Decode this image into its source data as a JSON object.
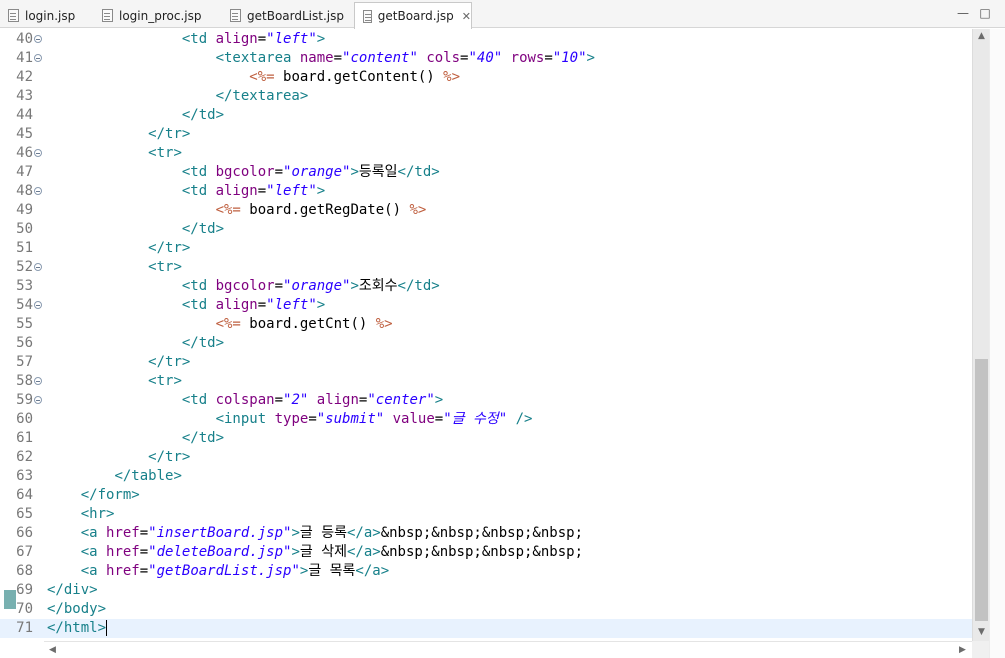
{
  "tabs": [
    {
      "label": "login.jsp",
      "active": false
    },
    {
      "label": "login_proc.jsp",
      "active": false
    },
    {
      "label": "getBoardList.jsp",
      "active": false
    },
    {
      "label": "getBoard.jsp",
      "active": true
    }
  ],
  "window_controls": {
    "minimize": "—",
    "maximize": "□"
  },
  "icons": {
    "file": "jsp-file-icon",
    "close": "close-icon",
    "fold": "fold-collapse-icon"
  },
  "colors": {
    "tag": "#17808a",
    "attribute": "#7f007f",
    "value": "#2a00ff",
    "scriptlet": "#bf5f3f",
    "current_line": "#e8f2fe"
  },
  "editor": {
    "current_line": 71,
    "lines": [
      {
        "num": 40,
        "fold": true,
        "tokens": [
          [
            "",
            "                "
          ],
          [
            "tg",
            "<td "
          ],
          [
            "at",
            "align"
          ],
          [
            "tx",
            "="
          ],
          [
            "vl",
            "\"left\""
          ],
          [
            "tg",
            ">"
          ]
        ]
      },
      {
        "num": 41,
        "fold": true,
        "tokens": [
          [
            "",
            "                    "
          ],
          [
            "tg",
            "<textarea "
          ],
          [
            "at",
            "name"
          ],
          [
            "tx",
            "="
          ],
          [
            "vl",
            "\"content\""
          ],
          [
            "tx",
            " "
          ],
          [
            "at",
            "cols"
          ],
          [
            "tx",
            "="
          ],
          [
            "vl",
            "\"40\""
          ],
          [
            "tx",
            " "
          ],
          [
            "at",
            "rows"
          ],
          [
            "tx",
            "="
          ],
          [
            "vl",
            "\"10\""
          ],
          [
            "tg",
            ">"
          ]
        ]
      },
      {
        "num": 42,
        "fold": false,
        "tokens": [
          [
            "",
            "                        "
          ],
          [
            "sc",
            "<%="
          ],
          [
            "tx",
            " board.getContent() "
          ],
          [
            "sc",
            "%>"
          ]
        ]
      },
      {
        "num": 43,
        "fold": false,
        "tokens": [
          [
            "",
            "                    "
          ],
          [
            "tg",
            "</textarea>"
          ]
        ]
      },
      {
        "num": 44,
        "fold": false,
        "tokens": [
          [
            "",
            "                "
          ],
          [
            "tg",
            "</td>"
          ]
        ]
      },
      {
        "num": 45,
        "fold": false,
        "tokens": [
          [
            "",
            "            "
          ],
          [
            "tg",
            "</tr>"
          ]
        ]
      },
      {
        "num": 46,
        "fold": true,
        "tokens": [
          [
            "",
            "            "
          ],
          [
            "tg",
            "<tr>"
          ]
        ]
      },
      {
        "num": 47,
        "fold": false,
        "tokens": [
          [
            "",
            "                "
          ],
          [
            "tg",
            "<td "
          ],
          [
            "at",
            "bgcolor"
          ],
          [
            "tx",
            "="
          ],
          [
            "vl",
            "\"orange\""
          ],
          [
            "tg",
            ">"
          ],
          [
            "tx",
            "등록일"
          ],
          [
            "tg",
            "</td>"
          ]
        ]
      },
      {
        "num": 48,
        "fold": true,
        "tokens": [
          [
            "",
            "                "
          ],
          [
            "tg",
            "<td "
          ],
          [
            "at",
            "align"
          ],
          [
            "tx",
            "="
          ],
          [
            "vl",
            "\"left\""
          ],
          [
            "tg",
            ">"
          ]
        ]
      },
      {
        "num": 49,
        "fold": false,
        "tokens": [
          [
            "",
            "                    "
          ],
          [
            "sc",
            "<%="
          ],
          [
            "tx",
            " board.getRegDate() "
          ],
          [
            "sc",
            "%>"
          ]
        ]
      },
      {
        "num": 50,
        "fold": false,
        "tokens": [
          [
            "",
            "                "
          ],
          [
            "tg",
            "</td>"
          ]
        ]
      },
      {
        "num": 51,
        "fold": false,
        "tokens": [
          [
            "",
            "            "
          ],
          [
            "tg",
            "</tr>"
          ]
        ]
      },
      {
        "num": 52,
        "fold": true,
        "tokens": [
          [
            "",
            "            "
          ],
          [
            "tg",
            "<tr>"
          ]
        ]
      },
      {
        "num": 53,
        "fold": false,
        "tokens": [
          [
            "",
            "                "
          ],
          [
            "tg",
            "<td "
          ],
          [
            "at",
            "bgcolor"
          ],
          [
            "tx",
            "="
          ],
          [
            "vl",
            "\"orange\""
          ],
          [
            "tg",
            ">"
          ],
          [
            "tx",
            "조회수"
          ],
          [
            "tg",
            "</td>"
          ]
        ]
      },
      {
        "num": 54,
        "fold": true,
        "tokens": [
          [
            "",
            "                "
          ],
          [
            "tg",
            "<td "
          ],
          [
            "at",
            "align"
          ],
          [
            "tx",
            "="
          ],
          [
            "vl",
            "\"left\""
          ],
          [
            "tg",
            ">"
          ]
        ]
      },
      {
        "num": 55,
        "fold": false,
        "tokens": [
          [
            "",
            "                    "
          ],
          [
            "sc",
            "<%="
          ],
          [
            "tx",
            " board.getCnt() "
          ],
          [
            "sc",
            "%>"
          ]
        ]
      },
      {
        "num": 56,
        "fold": false,
        "tokens": [
          [
            "",
            "                "
          ],
          [
            "tg",
            "</td>"
          ]
        ]
      },
      {
        "num": 57,
        "fold": false,
        "tokens": [
          [
            "",
            "            "
          ],
          [
            "tg",
            "</tr>"
          ]
        ]
      },
      {
        "num": 58,
        "fold": true,
        "tokens": [
          [
            "",
            "            "
          ],
          [
            "tg",
            "<tr>"
          ]
        ]
      },
      {
        "num": 59,
        "fold": true,
        "tokens": [
          [
            "",
            "                "
          ],
          [
            "tg",
            "<td "
          ],
          [
            "at",
            "colspan"
          ],
          [
            "tx",
            "="
          ],
          [
            "vl",
            "\"2\""
          ],
          [
            "tx",
            " "
          ],
          [
            "at",
            "align"
          ],
          [
            "tx",
            "="
          ],
          [
            "vl",
            "\"center\""
          ],
          [
            "tg",
            ">"
          ]
        ]
      },
      {
        "num": 60,
        "fold": false,
        "tokens": [
          [
            "",
            "                    "
          ],
          [
            "tg",
            "<input "
          ],
          [
            "at",
            "type"
          ],
          [
            "tx",
            "="
          ],
          [
            "vl",
            "\"submit\""
          ],
          [
            "tx",
            " "
          ],
          [
            "at",
            "value"
          ],
          [
            "tx",
            "="
          ],
          [
            "vl",
            "\"글 수정\""
          ],
          [
            "tx",
            " "
          ],
          [
            "tg",
            "/>"
          ]
        ]
      },
      {
        "num": 61,
        "fold": false,
        "tokens": [
          [
            "",
            "                "
          ],
          [
            "tg",
            "</td>"
          ]
        ]
      },
      {
        "num": 62,
        "fold": false,
        "tokens": [
          [
            "",
            "            "
          ],
          [
            "tg",
            "</tr>"
          ]
        ]
      },
      {
        "num": 63,
        "fold": false,
        "tokens": [
          [
            "",
            "        "
          ],
          [
            "tg",
            "</table>"
          ]
        ]
      },
      {
        "num": 64,
        "fold": false,
        "tokens": [
          [
            "",
            "    "
          ],
          [
            "tg",
            "</form>"
          ]
        ]
      },
      {
        "num": 65,
        "fold": false,
        "tokens": [
          [
            "",
            "    "
          ],
          [
            "tg",
            "<hr>"
          ]
        ]
      },
      {
        "num": 66,
        "fold": false,
        "tokens": [
          [
            "",
            "    "
          ],
          [
            "tg",
            "<a "
          ],
          [
            "at",
            "href"
          ],
          [
            "tx",
            "="
          ],
          [
            "vl",
            "\"insertBoard.jsp\""
          ],
          [
            "tg",
            ">"
          ],
          [
            "tx",
            "글 등록"
          ],
          [
            "tg",
            "</a>"
          ],
          [
            "tx",
            "&nbsp;&nbsp;&nbsp;&nbsp;"
          ]
        ]
      },
      {
        "num": 67,
        "fold": false,
        "tokens": [
          [
            "",
            "    "
          ],
          [
            "tg",
            "<a "
          ],
          [
            "at",
            "href"
          ],
          [
            "tx",
            "="
          ],
          [
            "vl",
            "\"deleteBoard.jsp\""
          ],
          [
            "tg",
            ">"
          ],
          [
            "tx",
            "글 삭제"
          ],
          [
            "tg",
            "</a>"
          ],
          [
            "tx",
            "&nbsp;&nbsp;&nbsp;&nbsp;"
          ]
        ]
      },
      {
        "num": 68,
        "fold": false,
        "tokens": [
          [
            "",
            "    "
          ],
          [
            "tg",
            "<a "
          ],
          [
            "at",
            "href"
          ],
          [
            "tx",
            "="
          ],
          [
            "vl",
            "\"getBoardList.jsp\""
          ],
          [
            "tg",
            ">"
          ],
          [
            "tx",
            "글 목록"
          ],
          [
            "tg",
            "</a>"
          ]
        ]
      },
      {
        "num": 69,
        "fold": false,
        "tokens": [
          [
            "tg",
            "</div>"
          ]
        ]
      },
      {
        "num": 70,
        "fold": false,
        "tokens": [
          [
            "tg",
            "</body>"
          ]
        ]
      },
      {
        "num": 71,
        "fold": false,
        "tokens": [
          [
            "tg",
            "</html>"
          ]
        ]
      }
    ]
  }
}
